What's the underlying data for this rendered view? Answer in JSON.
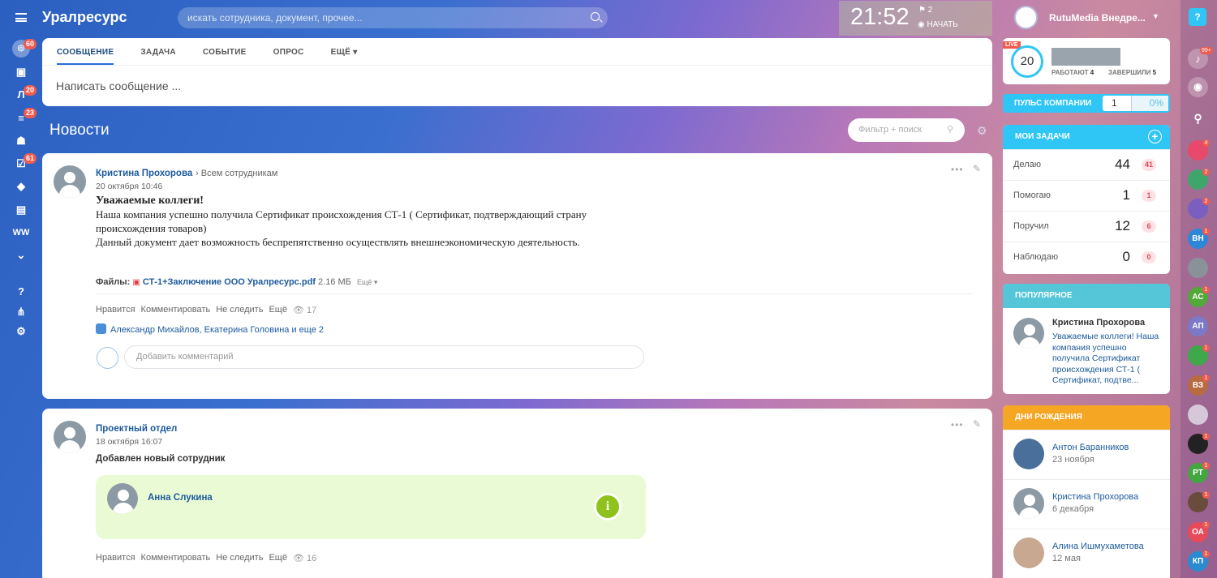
{
  "header": {
    "logo": "Уралресурс",
    "search_placeholder": "искать сотрудника, документ, прочее...",
    "time": "21:52",
    "flag_count": "2",
    "start_label": "НАЧАТЬ",
    "user_name": "RutuMedia Внедре..."
  },
  "sidebar": {
    "counts": {
      "live": "60",
      "l": "20",
      "filter": "23",
      "tasks": "61"
    },
    "l_label": "Л",
    "ww_label": "WW"
  },
  "composer": {
    "tabs": [
      "СООБЩЕНИЕ",
      "ЗАДАЧА",
      "СОБЫТИЕ",
      "ОПРОС",
      "ЕЩЁ"
    ],
    "placeholder": "Написать сообщение ..."
  },
  "news": {
    "title": "Новости",
    "filter_placeholder": "Фильтр + поиск"
  },
  "post1": {
    "author": "Кристина Прохорова",
    "to": "Всем сотрудникам",
    "date": "20 октября 10:46",
    "heading": "Уважаемые коллеги!",
    "line1": "Наша компания успешно получила Сертификат происхождения СТ-1 ( Сертификат, подтверждающий страну",
    "line2": "происхождения товаров)",
    "line3": "Данный документ дает возможность беспрепятственно осуществлять внешнеэкономическую деятельность.",
    "files_label": "Файлы:",
    "file_name": "СТ-1+Заключение ООО Уралресурс.pdf",
    "file_size": "2.16 МБ",
    "file_more": "Ещё",
    "actions": [
      "Нравится",
      "Комментировать",
      "Не следить",
      "Ещё"
    ],
    "views": "17",
    "likes": "Александр Михайлов, Екатерина Головина и еще 2",
    "comment_placeholder": "Добавить комментарий"
  },
  "post2": {
    "author": "Проектный отдел",
    "date": "18 октября 16:07",
    "text": "Добавлен новый сотрудник",
    "employee": "Анна Слукина",
    "actions": [
      "Нравится",
      "Комментировать",
      "Не следить",
      "Ещё"
    ],
    "views": "16"
  },
  "live": {
    "badge": "LIVE",
    "count": "20",
    "working_label": "РАБОТАЮТ",
    "working": "4",
    "finished_label": "ЗАВЕРШИЛИ",
    "finished": "5"
  },
  "pulse": {
    "label": "ПУЛЬС КОМПАНИИ",
    "value": "1",
    "percent": "0%"
  },
  "tasks": {
    "title": "МОИ ЗАДАЧИ",
    "rows": [
      {
        "label": "Делаю",
        "value": "44",
        "badge": "41"
      },
      {
        "label": "Помогаю",
        "value": "1",
        "badge": "1"
      },
      {
        "label": "Поручил",
        "value": "12",
        "badge": "6"
      },
      {
        "label": "Наблюдаю",
        "value": "0",
        "badge": "0"
      }
    ]
  },
  "popular": {
    "title": "ПОПУЛЯРНОЕ",
    "author": "Кристина Прохорова",
    "text": "Уважаемые коллеги! Наша компания успешно получила Сертификат происхождения СТ-1 ( Сертификат, подтве..."
  },
  "birthdays": {
    "title": "ДНИ РОЖДЕНИЯ",
    "people": [
      {
        "name": "Антон Баранников",
        "date": "23 ноября"
      },
      {
        "name": "Кристина Прохорова",
        "date": "6 декабря"
      },
      {
        "name": "Алина Ишмухаметова",
        "date": "12 мая"
      }
    ]
  },
  "rightbar": {
    "notif": "99+",
    "items": [
      {
        "initials": "",
        "count": "4",
        "color": "#e8486a"
      },
      {
        "initials": "",
        "count": "2",
        "color": "#3fa66b"
      },
      {
        "initials": "",
        "count": "2",
        "color": "#7b5fc0"
      },
      {
        "initials": "ВН",
        "count": "1",
        "color": "#2d87d8"
      },
      {
        "initials": "",
        "count": "",
        "color": "#8a9299"
      },
      {
        "initials": "АС",
        "count": "1",
        "color": "#53a83a"
      },
      {
        "initials": "АП",
        "count": "",
        "color": "#7c79c8"
      },
      {
        "initials": "",
        "count": "1",
        "color": "#3ea84a"
      },
      {
        "initials": "ВЗ",
        "count": "1",
        "color": "#b86a40"
      },
      {
        "initials": "",
        "count": "",
        "color": "#d6c8d8"
      },
      {
        "initials": "",
        "count": "1",
        "color": "#222"
      },
      {
        "initials": "РТ",
        "count": "1",
        "color": "#44a640"
      },
      {
        "initials": "",
        "count": "1",
        "color": "#6a4c3c"
      },
      {
        "initials": "ОА",
        "count": "1",
        "color": "#e84a5a"
      },
      {
        "initials": "КП",
        "count": "1",
        "color": "#2a8ad0"
      }
    ]
  },
  "colors": {
    "tasks_header": "#2fc6f6",
    "popular_header": "#55c6d8",
    "birthday_header": "#f5a623",
    "link": "#1d5a9c"
  }
}
